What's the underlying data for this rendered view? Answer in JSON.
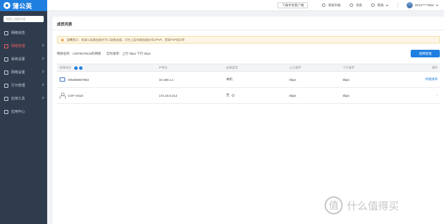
{
  "app": {
    "logo_text": "蒲公英",
    "search_placeholder": "搜索入搜索内容"
  },
  "sidebar": {
    "items": [
      {
        "label": "网络状态",
        "active": false
      },
      {
        "label": "网络管理",
        "active": true
      },
      {
        "label": "系统设置",
        "active": false
      },
      {
        "label": "网络设置",
        "active": false
      },
      {
        "label": "行为管理",
        "active": false
      },
      {
        "label": "应用工具",
        "active": false
      },
      {
        "label": "应用中心",
        "active": false
      }
    ]
  },
  "topbar": {
    "download_label": "下载手机客户端",
    "upgrade_label": "系统升级",
    "news_label": "消息",
    "help_label": "帮助",
    "user_label": "0013****7853"
  },
  "page": {
    "title": "成员列表",
    "notice": "温馨提示：若蒲公英路由器作为二级路由器，可在上层的路由器启用UPNP，提高P2P成功率",
    "network_name": "网络名称：13878675519的网络",
    "speed": "实时速率：上行 0bps  下行 0bps",
    "manage_button": "组网管理"
  },
  "table": {
    "headers": [
      "网络成员",
      "IP地址",
      "连接类型",
      "上行速率",
      "下行速率",
      "操作"
    ],
    "rows": [
      {
        "name": "005355867853",
        "ip": "10.168.1.1",
        "type": "本机",
        "up": "0bps",
        "down": "0bps",
        "action": "终端清单"
      },
      {
        "name": "CXF-AN10",
        "ip": "172.16.0.214",
        "type": "无",
        "up": "0bps",
        "down": "0bps",
        "action": "-"
      }
    ]
  },
  "watermark": {
    "text": "什么值得买",
    "logo": "值"
  },
  "colors": {
    "sidebar_bg": "#2f3c4e",
    "accent": "#1f7fe0",
    "notice_bg": "#fdf6e6",
    "active_nav": "#e85f5f"
  }
}
